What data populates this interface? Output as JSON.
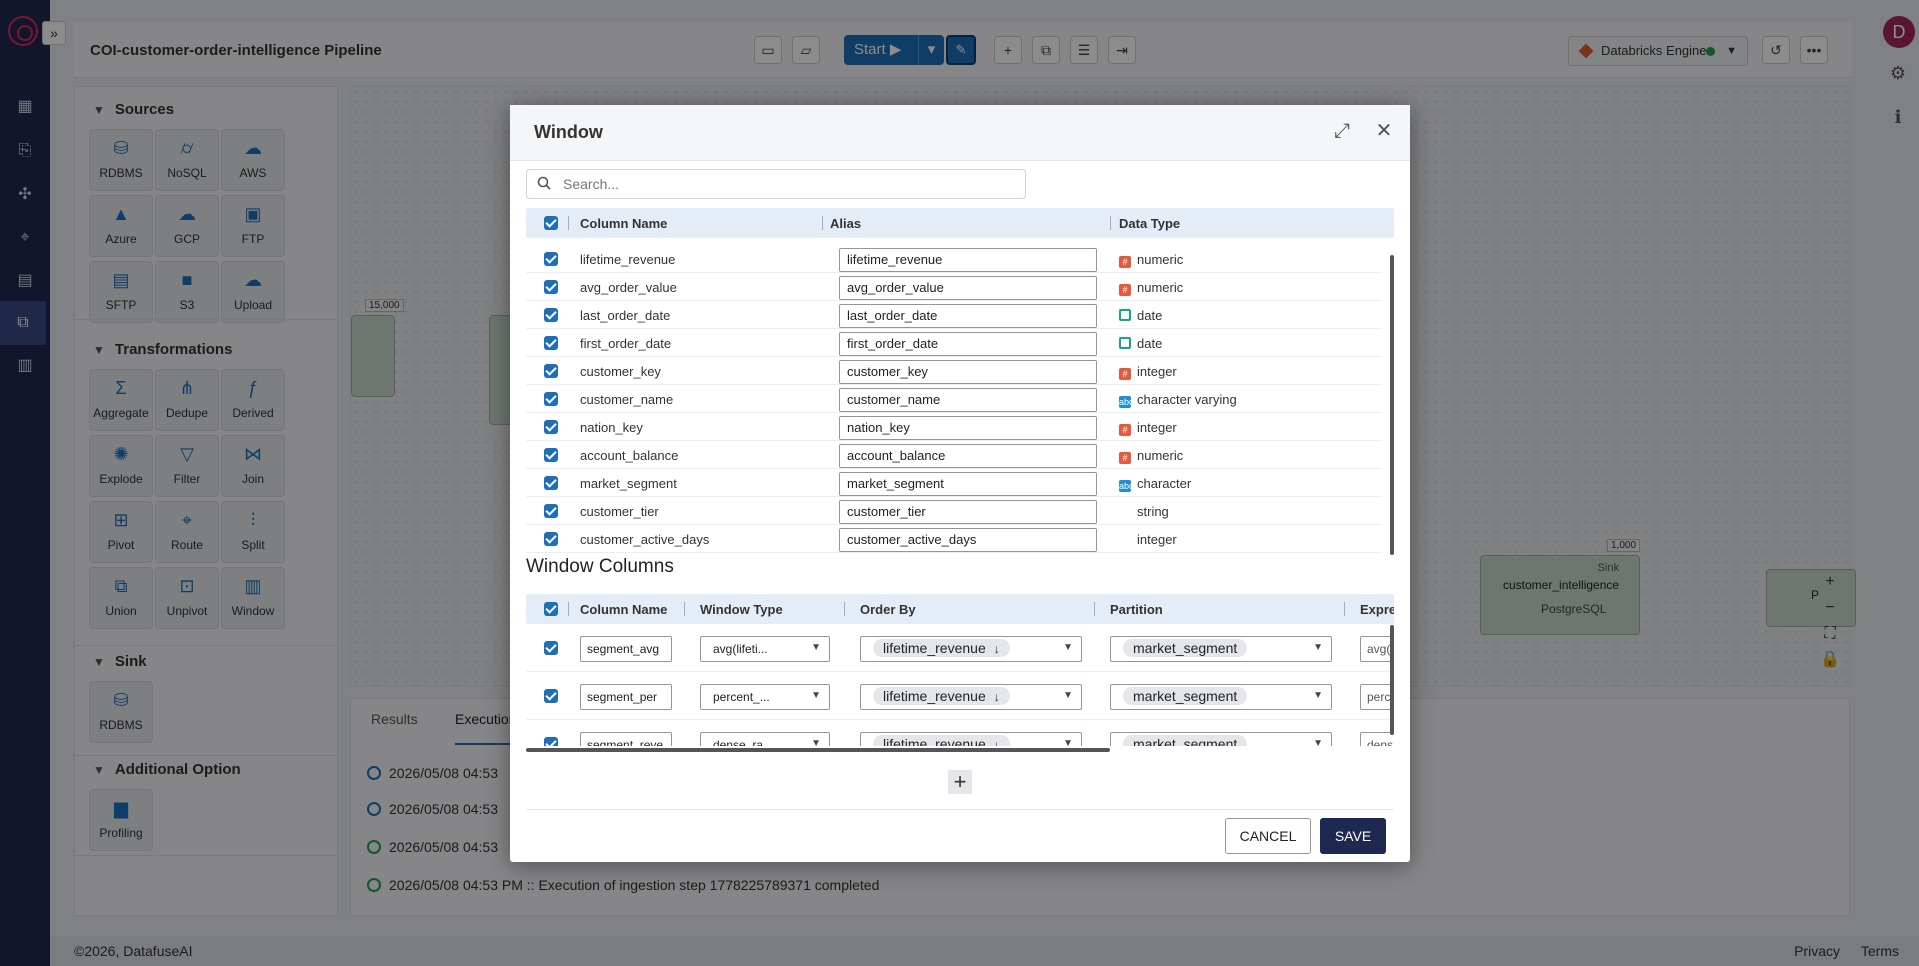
{
  "app": {
    "pipeline_title": "COI-customer-order-intelligence Pipeline",
    "user_initial": "D",
    "start_label": "Start",
    "engine_label": "Databricks Engine",
    "colors": {
      "accent": "#1e6fb8",
      "nav": "#1f2850",
      "danger": "#e35a3c",
      "success": "#1aa34a"
    }
  },
  "palette": {
    "sources": {
      "title": "Sources",
      "items": [
        {
          "label": "RDBMS",
          "icon": "database-icon"
        },
        {
          "label": "NoSQL",
          "icon": "cylinder-icon"
        },
        {
          "label": "AWS",
          "icon": "aws-icon"
        },
        {
          "label": "Azure",
          "icon": "azure-icon"
        },
        {
          "label": "GCP",
          "icon": "gcp-icon"
        },
        {
          "label": "FTP",
          "icon": "ftp-icon"
        },
        {
          "label": "SFTP",
          "icon": "sftp-icon"
        },
        {
          "label": "S3",
          "icon": "s3-icon"
        },
        {
          "label": "Upload",
          "icon": "cloud-upload-icon"
        }
      ]
    },
    "transformations": {
      "title": "Transformations",
      "items": [
        {
          "label": "Aggregate",
          "icon": "sigma-icon"
        },
        {
          "label": "Dedupe",
          "icon": "dedupe-icon"
        },
        {
          "label": "Derived",
          "icon": "derived-icon"
        },
        {
          "label": "Explode",
          "icon": "explode-icon"
        },
        {
          "label": "Filter",
          "icon": "filter-icon"
        },
        {
          "label": "Join",
          "icon": "join-icon"
        },
        {
          "label": "Pivot",
          "icon": "pivot-icon"
        },
        {
          "label": "Route",
          "icon": "route-icon"
        },
        {
          "label": "Split",
          "icon": "split-icon"
        },
        {
          "label": "Union",
          "icon": "union-icon"
        },
        {
          "label": "Unpivot",
          "icon": "unpivot-icon"
        },
        {
          "label": "Window",
          "icon": "window-icon"
        }
      ]
    },
    "sink": {
      "title": "Sink",
      "items": [
        {
          "label": "RDBMS",
          "icon": "database-icon"
        }
      ]
    },
    "additional": {
      "title": "Additional Option",
      "items": [
        {
          "label": "Profiling",
          "icon": "bar-chart-icon"
        }
      ]
    }
  },
  "canvas": {
    "count_left": "15,000",
    "count_sink": "1,000",
    "sink_node": {
      "badge": "Sink",
      "name": "customer_intelligence",
      "engine": "PostgreSQL"
    },
    "profiling_node_partial": "P"
  },
  "results": {
    "tabs": [
      "Results",
      "Execution"
    ],
    "logs": [
      {
        "text": "2026/05/08 04:53",
        "status": "running"
      },
      {
        "text": "2026/05/08 04:53",
        "status": "running"
      },
      {
        "text": "2026/05/08 04:53",
        "status": "done"
      },
      {
        "text": "2026/05/08 04:53 PM :: Execution of ingestion step 1778225789371 completed",
        "status": "done"
      }
    ]
  },
  "footer": {
    "copyright": "©2026, DatafuseAI",
    "privacy": "Privacy",
    "terms": "Terms"
  },
  "modal": {
    "title": "Window",
    "search_placeholder": "Search...",
    "columns_table": {
      "headers": [
        "Column Name",
        "Alias",
        "Data Type"
      ],
      "rows": [
        {
          "name": "lifetime_revenue",
          "alias": "lifetime_revenue",
          "type": "numeric",
          "kind": "num"
        },
        {
          "name": "avg_order_value",
          "alias": "avg_order_value",
          "type": "numeric",
          "kind": "num"
        },
        {
          "name": "last_order_date",
          "alias": "last_order_date",
          "type": "date",
          "kind": "date"
        },
        {
          "name": "first_order_date",
          "alias": "first_order_date",
          "type": "date",
          "kind": "date"
        },
        {
          "name": "customer_key",
          "alias": "customer_key",
          "type": "integer",
          "kind": "num"
        },
        {
          "name": "customer_name",
          "alias": "customer_name",
          "type": "character varying",
          "kind": "chr"
        },
        {
          "name": "nation_key",
          "alias": "nation_key",
          "type": "integer",
          "kind": "num"
        },
        {
          "name": "account_balance",
          "alias": "account_balance",
          "type": "numeric",
          "kind": "num"
        },
        {
          "name": "market_segment",
          "alias": "market_segment",
          "type": "character",
          "kind": "chr"
        },
        {
          "name": "customer_tier",
          "alias": "customer_tier",
          "type": "string",
          "kind": "none"
        },
        {
          "name": "customer_active_days",
          "alias": "customer_active_days",
          "type": "integer",
          "kind": "none"
        }
      ]
    },
    "window_columns": {
      "title": "Window Columns",
      "headers": [
        "Column Name",
        "Window Type",
        "Order By",
        "Partition",
        "Expres"
      ],
      "rows": [
        {
          "name": "segment_avg",
          "type": "avg(lifeti...",
          "order_by": "lifetime_revenue",
          "partition": "market_segment",
          "expr": "avg("
        },
        {
          "name": "segment_per",
          "type": "percent_...",
          "order_by": "lifetime_revenue",
          "partition": "market_segment",
          "expr": "perc"
        },
        {
          "name": "segment_reve",
          "type": "dense_ra...",
          "order_by": "lifetime_revenue",
          "partition": "market_segment",
          "expr": "dens"
        }
      ]
    },
    "cancel_label": "CANCEL",
    "save_label": "SAVE"
  }
}
